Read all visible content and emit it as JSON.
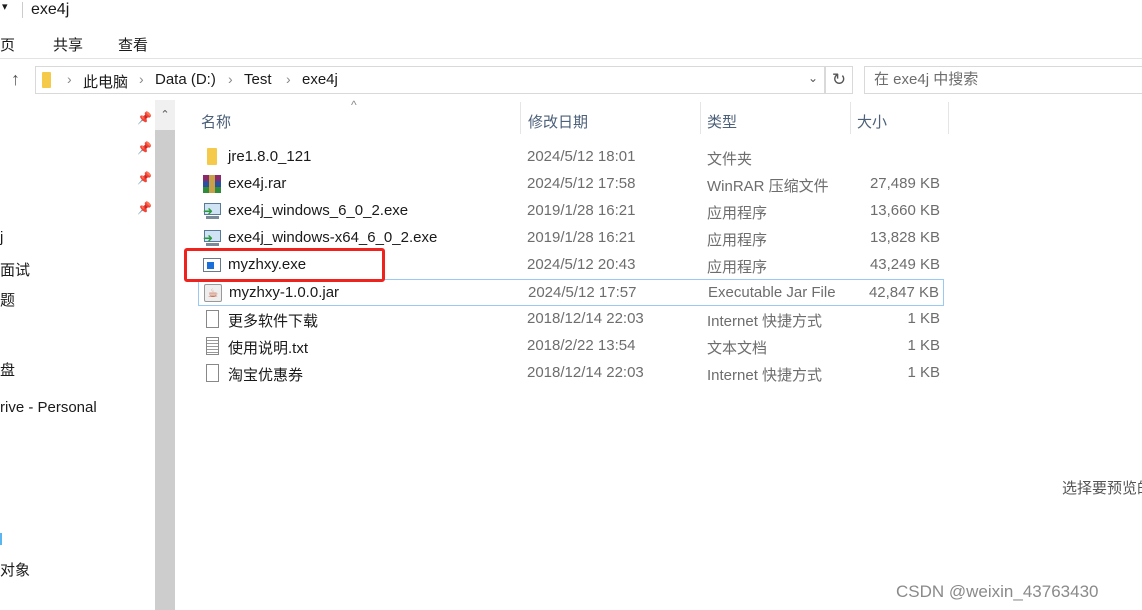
{
  "window": {
    "title": "exe4j"
  },
  "ribbon": {
    "tabs": [
      "主页",
      "共享",
      "查看"
    ]
  },
  "address": {
    "crumbs": [
      "此电脑",
      "Data (D:)",
      "Test",
      "exe4j"
    ],
    "search_placeholder": "在 exe4j 中搜索"
  },
  "nav": {
    "items": [
      "j",
      "面试",
      "题",
      "盘",
      "rive - Personal",
      "",
      "对象"
    ]
  },
  "columns": {
    "name": "名称",
    "date": "修改日期",
    "type": "类型",
    "size": "大小"
  },
  "files": [
    {
      "name": "jre1.8.0_121",
      "date": "2024/5/12 18:01",
      "type": "文件夹",
      "size": "",
      "icon": "folder-icon"
    },
    {
      "name": "exe4j.rar",
      "date": "2024/5/12 17:58",
      "type": "WinRAR 压缩文件",
      "size": "27,489 KB",
      "icon": "winrar-icon"
    },
    {
      "name": "exe4j_windows_6_0_2.exe",
      "date": "2019/1/28 16:21",
      "type": "应用程序",
      "size": "13,660 KB",
      "icon": "installer-icon"
    },
    {
      "name": "exe4j_windows-x64_6_0_2.exe",
      "date": "2019/1/28 16:21",
      "type": "应用程序",
      "size": "13,828 KB",
      "icon": "installer-icon"
    },
    {
      "name": "myzhxy.exe",
      "date": "2024/5/12 20:43",
      "type": "应用程序",
      "size": "43,249 KB",
      "icon": "app-window-icon"
    },
    {
      "name": "myzhxy-1.0.0.jar",
      "date": "2024/5/12 17:57",
      "type": "Executable Jar File",
      "size": "42,847 KB",
      "icon": "java-icon"
    },
    {
      "name": "更多软件下载",
      "date": "2018/12/14 22:03",
      "type": "Internet 快捷方式",
      "size": "1 KB",
      "icon": "file-icon"
    },
    {
      "name": "使用说明.txt",
      "date": "2018/2/22 13:54",
      "type": "文本文档",
      "size": "1 KB",
      "icon": "text-file-icon"
    },
    {
      "name": "淘宝优惠券",
      "date": "2018/12/14 22:03",
      "type": "Internet 快捷方式",
      "size": "1 KB",
      "icon": "file-icon"
    }
  ],
  "preview": {
    "text": "选择要预览的"
  },
  "watermark": "CSDN @weixin_43763430",
  "colors": {
    "highlight": "#f0221e",
    "hover_border": "#99c9f5"
  }
}
